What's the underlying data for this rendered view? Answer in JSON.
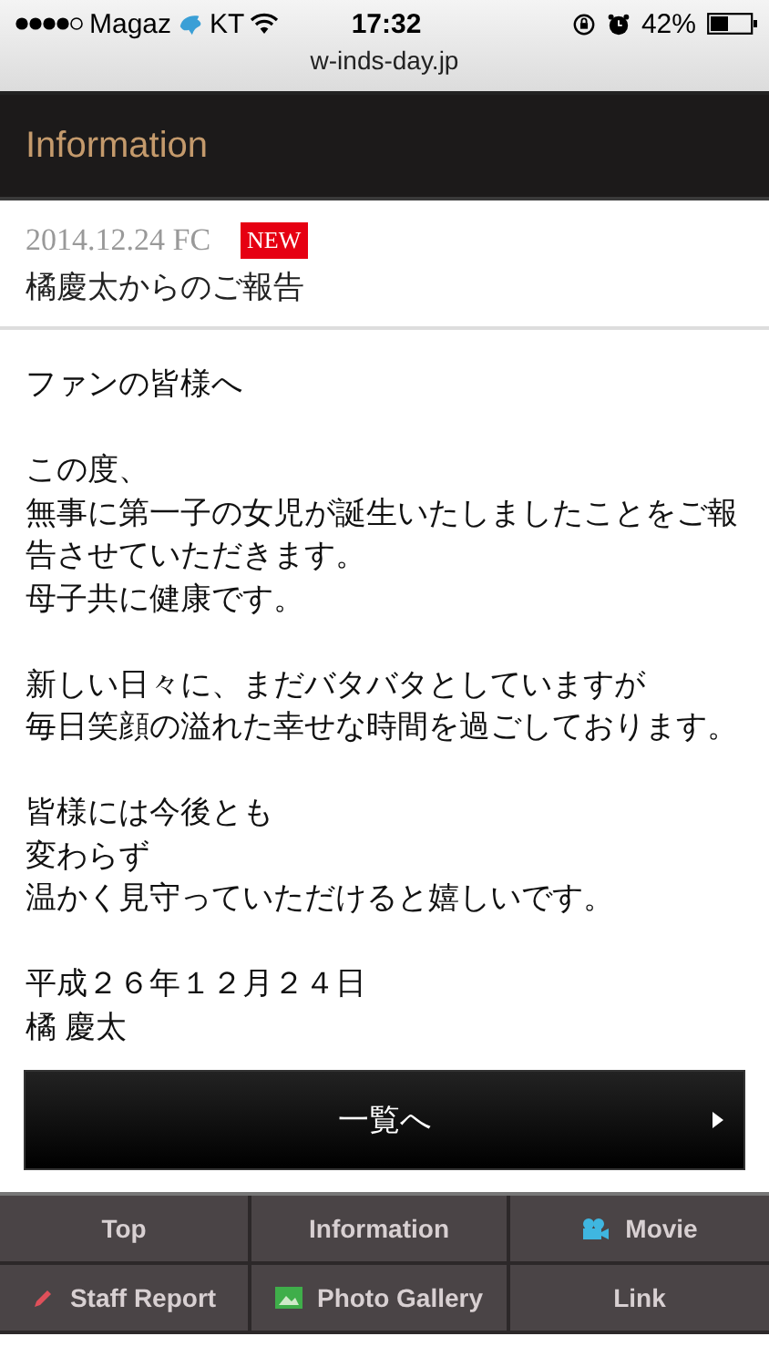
{
  "status_bar": {
    "carrier_prefix": "Magaz",
    "carrier_suffix": "KT",
    "time": "17:32",
    "battery": "42%"
  },
  "address_bar": {
    "url": "w-inds-day.jp"
  },
  "section_title": "Information",
  "entry": {
    "date": "2014.12.24 FC",
    "badge": "NEW",
    "title": "橘慶太からのご報告"
  },
  "body": [
    [
      "ファンの皆様へ"
    ],
    [
      "この度、",
      "無事に第一子の女児が誕生いたしましたことをご報告させていただきます。",
      "母子共に健康です。"
    ],
    [
      "新しい日々に、まだバタバタとしていますが",
      "毎日笑顔の溢れた幸せな時間を過ごしております。"
    ],
    [
      "皆様には今後とも",
      "変わらず",
      "温かく見守っていただけると嬉しいです。"
    ],
    [
      "平成２６年１２月２４日",
      "橘 慶太"
    ]
  ],
  "list_button": "一覧へ",
  "nav": [
    {
      "label": "Top",
      "kind": "plain"
    },
    {
      "label": "Information",
      "kind": "plain"
    },
    {
      "label": "Movie",
      "kind": "movie"
    },
    {
      "label": "Staff Report",
      "kind": "report"
    },
    {
      "label": "Photo Gallery",
      "kind": "gallery"
    },
    {
      "label": "Link",
      "kind": "plain"
    }
  ]
}
